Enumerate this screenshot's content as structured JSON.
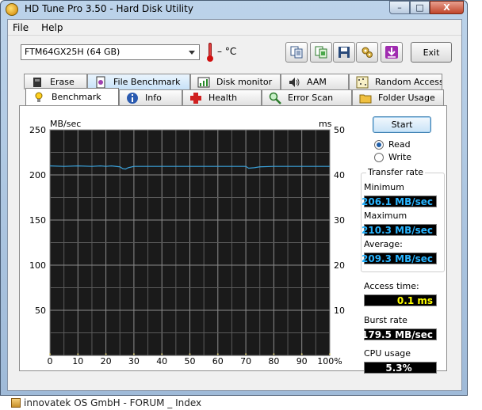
{
  "window": {
    "title": "HD Tune Pro 3.50 - Hard Disk Utility",
    "buttons": {
      "minimize": "–",
      "maximize": "□",
      "close": "X"
    }
  },
  "menu": {
    "file": "File",
    "help": "Help"
  },
  "toolbar": {
    "drive": "FTM64GX25H (64 GB)",
    "temperature": "– °C",
    "exit": "Exit",
    "icons": [
      "copy-info-icon",
      "copy-screen-icon",
      "save-icon",
      "options-icon",
      "download-icon"
    ]
  },
  "tabs": {
    "row1": [
      "Erase",
      "File Benchmark",
      "Disk monitor",
      "AAM",
      "Random Access"
    ],
    "row2": [
      "Benchmark",
      "Info",
      "Health",
      "Error Scan",
      "Folder Usage"
    ]
  },
  "controls": {
    "start": "Start",
    "read": "Read",
    "write": "Write",
    "mode_selected": "read"
  },
  "results": {
    "transfer_rate_title": "Transfer rate",
    "minimum_label": "Minimum",
    "minimum_value": "206.1 MB/sec",
    "maximum_label": "Maximum",
    "maximum_value": "210.3 MB/sec",
    "average_label": "Average:",
    "average_value": "209.3 MB/sec",
    "access_time_label": "Access time:",
    "access_time_value": "0.1 ms",
    "burst_rate_label": "Burst rate",
    "burst_rate_value": "179.5 MB/sec",
    "cpu_usage_label": "CPU usage",
    "cpu_usage_value": "5.3%"
  },
  "chart_data": {
    "type": "line",
    "ylabel_left": "MB/sec",
    "ylabel_right": "ms",
    "ylim_left": [
      0,
      250
    ],
    "ylim_right": [
      0,
      50
    ],
    "xlim": [
      0,
      100
    ],
    "y_ticks_left": [
      50,
      100,
      150,
      200,
      250
    ],
    "y_ticks_right": [
      10,
      20,
      30,
      40,
      50
    ],
    "x_ticks": [
      "0",
      "10",
      "20",
      "30",
      "40",
      "50",
      "60",
      "70",
      "80",
      "90",
      "100%"
    ],
    "grid": true,
    "colors": {
      "background": "#1a1a1a",
      "grid": "#8c8c8c",
      "transfer": "#3aa0d8",
      "access": "#e0d070"
    },
    "series": [
      {
        "x": [
          0,
          5,
          10,
          15,
          18,
          20,
          22,
          25,
          26,
          27,
          28,
          30,
          35,
          40,
          45,
          50,
          55,
          60,
          65,
          70,
          71,
          73,
          75,
          80,
          85,
          90,
          95,
          100
        ],
        "values": [
          210,
          209.5,
          210,
          209.5,
          210,
          209.5,
          210,
          209,
          207,
          206.5,
          208,
          209.5,
          209.5,
          209.5,
          209.5,
          209.5,
          209.5,
          209.5,
          209.5,
          209.5,
          207.5,
          208,
          209,
          209.5,
          209.5,
          209.5,
          209.5,
          209.5
        ]
      },
      {
        "x": [
          0,
          10,
          20,
          30,
          40,
          50,
          60,
          70,
          80,
          90,
          100
        ],
        "values": [
          0.1,
          0.1,
          0.1,
          0.1,
          0.1,
          0.1,
          0.1,
          0.1,
          0.1,
          0.1,
          0.1
        ]
      }
    ]
  },
  "taskbar": {
    "text": "innovatek OS GmbH - FORUM _ Index"
  }
}
